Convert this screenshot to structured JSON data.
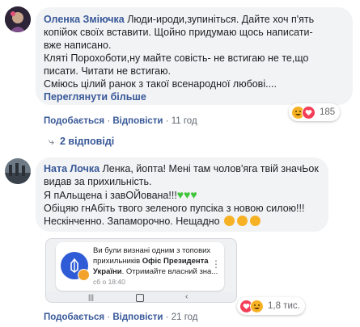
{
  "comment1": {
    "author": "Оленка Зміючка",
    "lines": [
      "Люди-ироди,зупиніться. Дайте хоч п'ять",
      "копійок своїх вставити. Щойно придумаю щось написати-",
      "вже написано.",
      "Кляті Порохоботи,ну майте совість- не встигаю не те,що",
      "писати. Читати не встигаю.",
      "Смiюсь цiлий ранок з такої всенародної любовi...."
    ],
    "see_more": "Переглянути більше",
    "like": "Подобається",
    "reply": "Відповісти",
    "time": "11 год",
    "reactions_count": "185",
    "replies_label": "2 відповіді"
  },
  "comment2": {
    "author": "Ната Лочка",
    "line1_after_name": "Ленка, йопта! Мені там чолов'яга твій значЬок",
    "lines": [
      "видав за прихильність.",
      "Я пАльщена і завОЙована!!!",
      "Обіцяю гнАбіть твого зеленого пупсіка з новою силою!!!",
      "Нескінченно. Запаморочно. Нещадно"
    ],
    "notification": {
      "text_before": "Ви були визнані одним з топових прихильників ",
      "bold": "Офіс Президента України",
      "text_after": ". Отримайте власний зна...",
      "time": "сб о 18:40"
    },
    "like": "Подобається",
    "reply": "Відповісти",
    "time": "21 год",
    "reactions_count": "1,8 тис."
  },
  "colors": {
    "link": "#385898",
    "bubble": "#f2f3f5",
    "green_heart": "#3fc53a",
    "love": "#f33e58",
    "haha": "#f7b125"
  }
}
